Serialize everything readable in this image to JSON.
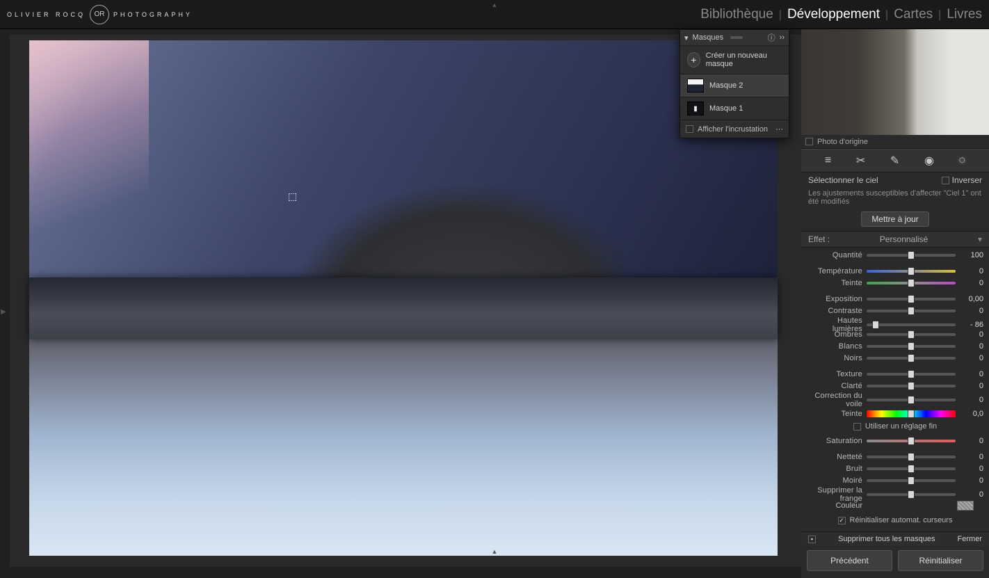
{
  "logo": {
    "left": "OLIVIER ROCQ",
    "right": "PHOTOGRAPHY",
    "mono": "OR"
  },
  "nav": {
    "library": "Bibliothèque",
    "develop": "Développement",
    "maps": "Cartes",
    "books": "Livres"
  },
  "photo_origin_label": "Photo d'origine",
  "mask_panel": {
    "title": "Masques",
    "new_mask": "Créer un nouveau masque",
    "items": [
      {
        "label": "Masque 2"
      },
      {
        "label": "Masque 1"
      }
    ],
    "show_overlay": "Afficher l'incrustation"
  },
  "selection_label": "Sélectionner le ciel",
  "invert_label": "Inverser",
  "update_hint": "Les ajustements susceptibles d'affecter \"Ciel 1\" ont été modifiés",
  "update_btn": "Mettre à jour",
  "effect_label": "Effet :",
  "effect_value": "Personnalisé",
  "sliders": [
    {
      "label": "Quantité",
      "value": "100",
      "pos": 50,
      "track": ""
    },
    {
      "label": "Température",
      "value": "0",
      "pos": 50,
      "track": "temp",
      "spaced": true
    },
    {
      "label": "Teinte",
      "value": "0",
      "pos": 50,
      "track": "tint"
    },
    {
      "label": "Exposition",
      "value": "0,00",
      "pos": 50,
      "track": "",
      "spaced": true
    },
    {
      "label": "Contraste",
      "value": "0",
      "pos": 50,
      "track": ""
    },
    {
      "label": "Hautes lumières",
      "value": "- 86",
      "pos": 10,
      "track": ""
    },
    {
      "label": "Ombres",
      "value": "0",
      "pos": 50,
      "track": ""
    },
    {
      "label": "Blancs",
      "value": "0",
      "pos": 50,
      "track": ""
    },
    {
      "label": "Noirs",
      "value": "0",
      "pos": 50,
      "track": ""
    },
    {
      "label": "Texture",
      "value": "0",
      "pos": 50,
      "track": "",
      "spaced": true
    },
    {
      "label": "Clarté",
      "value": "0",
      "pos": 50,
      "track": ""
    },
    {
      "label": "Correction du voile",
      "value": "0",
      "pos": 50,
      "track": ""
    },
    {
      "label": "Teinte",
      "value": "0,0",
      "pos": 50,
      "track": "hue",
      "spaced": true
    },
    {
      "label": "Saturation",
      "value": "0",
      "pos": 50,
      "track": "sat"
    },
    {
      "label": "Netteté",
      "value": "0",
      "pos": 50,
      "track": "",
      "spaced": true
    },
    {
      "label": "Bruit",
      "value": "0",
      "pos": 50,
      "track": ""
    },
    {
      "label": "Moiré",
      "value": "0",
      "pos": 50,
      "track": ""
    },
    {
      "label": "Supprimer la frange",
      "value": "0",
      "pos": 50,
      "track": ""
    }
  ],
  "fine_tune_label": "Utiliser un réglage fin",
  "color_label": "Couleur",
  "reset_auto": "Réinitialiser automat. curseurs",
  "reset_auto_checked": true,
  "delete_all": "Supprimer tous les masques",
  "close": "Fermer",
  "prev": "Précédent",
  "reset": "Réinitialiser"
}
